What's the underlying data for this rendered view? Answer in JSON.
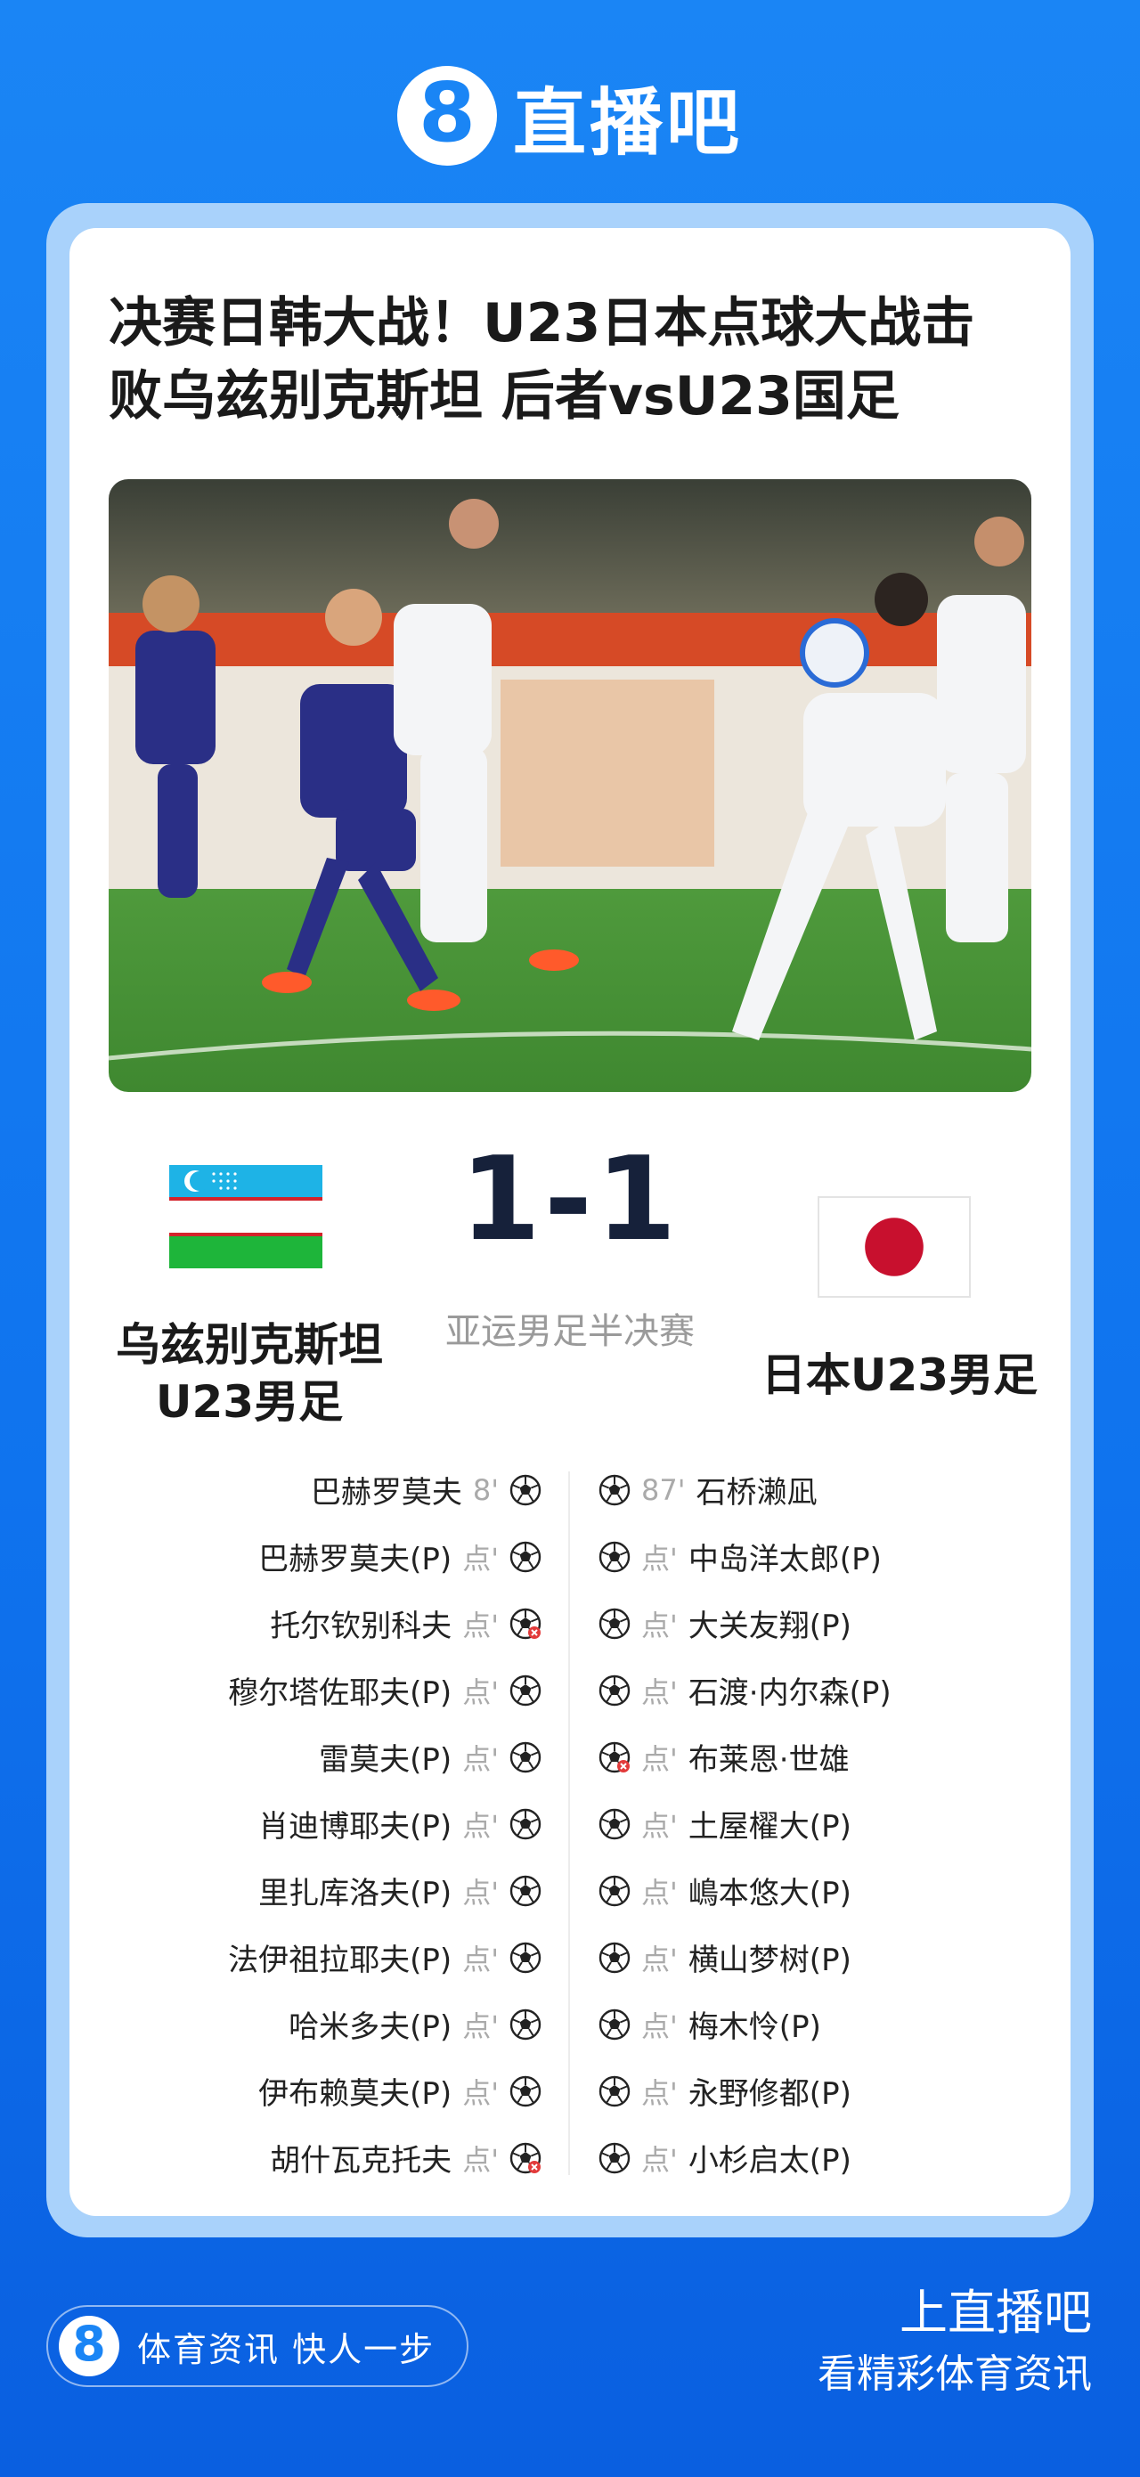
{
  "brand": {
    "badge": "8",
    "name": "直播吧"
  },
  "article": {
    "headline_line1": "决赛日韩大战！U23日本点球大战击",
    "headline_line2": "败乌兹别克斯坦 后者vsU23国足"
  },
  "match": {
    "score": "1-1",
    "stage": "亚运男足半决赛",
    "home": {
      "name_line1": "乌兹别克斯坦",
      "name_line2": "U23男足",
      "flag": "uzbekistan-flag"
    },
    "away": {
      "name": "日本U23男足",
      "flag": "japan-flag"
    }
  },
  "events": {
    "home": [
      {
        "player": "巴赫罗莫夫",
        "time": "8'",
        "icon": "goal"
      },
      {
        "player": "巴赫罗莫夫(P)",
        "time": "点'",
        "icon": "goal"
      },
      {
        "player": "托尔钦别科夫",
        "time": "点'",
        "icon": "missed"
      },
      {
        "player": "穆尔塔佐耶夫(P)",
        "time": "点'",
        "icon": "goal"
      },
      {
        "player": "雷莫夫(P)",
        "time": "点'",
        "icon": "goal"
      },
      {
        "player": "肖迪博耶夫(P)",
        "time": "点'",
        "icon": "goal"
      },
      {
        "player": "里扎库洛夫(P)",
        "time": "点'",
        "icon": "goal"
      },
      {
        "player": "法伊祖拉耶夫(P)",
        "time": "点'",
        "icon": "goal"
      },
      {
        "player": "哈米多夫(P)",
        "time": "点'",
        "icon": "goal"
      },
      {
        "player": "伊布赖莫夫(P)",
        "time": "点'",
        "icon": "goal"
      },
      {
        "player": "胡什瓦克托夫",
        "time": "点'",
        "icon": "missed"
      }
    ],
    "away": [
      {
        "player": "石桥濑凪",
        "time": "87'",
        "icon": "goal"
      },
      {
        "player": "中岛洋太郎(P)",
        "time": "点'",
        "icon": "goal"
      },
      {
        "player": "大关友翔(P)",
        "time": "点'",
        "icon": "goal"
      },
      {
        "player": "石渡·内尔森(P)",
        "time": "点'",
        "icon": "goal"
      },
      {
        "player": "布莱恩·世雄",
        "time": "点'",
        "icon": "missed"
      },
      {
        "player": "土屋櫂大(P)",
        "time": "点'",
        "icon": "goal"
      },
      {
        "player": "嶋本悠大(P)",
        "time": "点'",
        "icon": "goal"
      },
      {
        "player": "横山梦树(P)",
        "time": "点'",
        "icon": "goal"
      },
      {
        "player": "梅木怜(P)",
        "time": "点'",
        "icon": "goal"
      },
      {
        "player": "永野修都(P)",
        "time": "点'",
        "icon": "goal"
      },
      {
        "player": "小杉启太(P)",
        "time": "点'",
        "icon": "goal"
      }
    ]
  },
  "footer": {
    "pill_badge": "8",
    "pill_text": "体育资讯 快人一步",
    "right_line1": "上直播吧",
    "right_line2": "看精彩体育资讯"
  },
  "colors": {
    "background": "#1a85f5",
    "score": "#16213a",
    "japan_red": "#c8102e",
    "uzb_blue": "#1eb3e6",
    "uzb_green": "#1eb53a"
  }
}
